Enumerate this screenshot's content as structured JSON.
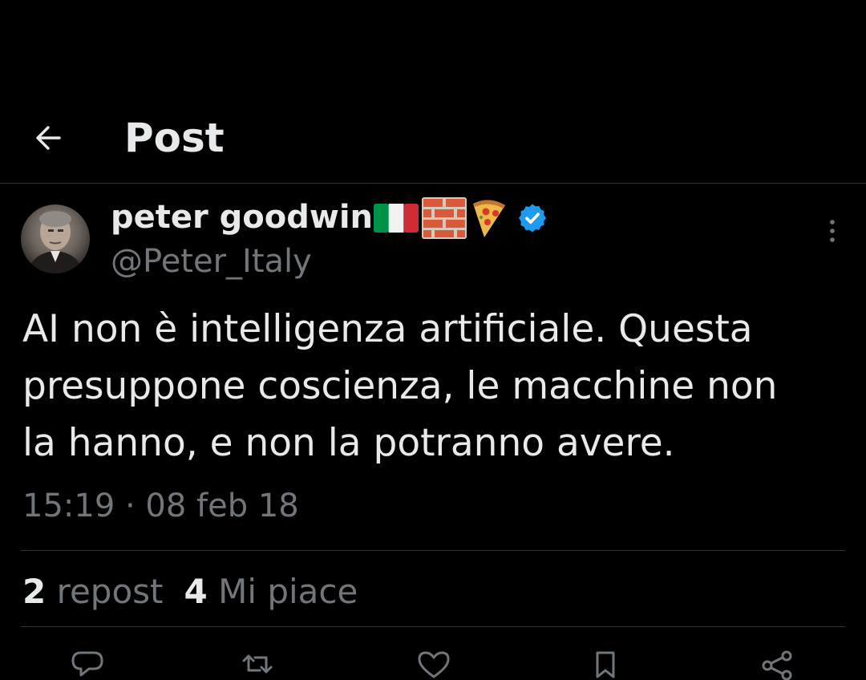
{
  "header": {
    "back_icon": "arrow-left-icon",
    "title": "Post"
  },
  "tweet": {
    "author": {
      "name": "peter goodwin",
      "handle": "@Peter_Italy",
      "emojis": [
        "italy-flag-icon",
        "brick-icon",
        "pizza-icon"
      ],
      "verified_icon": "verified-badge-icon",
      "verified_color": "#1d9bf0"
    },
    "text": "AI non è intelligenza artificiale. Questa\npresuppone coscienza, le macchine non\nla hanno, e non la potranno avere.",
    "timestamp": "15:19 · 08 feb 18",
    "stats": {
      "reposts_count": "2",
      "reposts_label": "repost",
      "likes_count": "4",
      "likes_label": "Mi piace"
    },
    "actions": [
      "reply-icon",
      "repost-icon",
      "like-icon",
      "bookmark-icon",
      "share-icon"
    ]
  },
  "colors": {
    "background": "#000000",
    "text_primary": "#e7e9ea",
    "text_secondary": "#71767b",
    "divider": "#2f3336",
    "accent": "#1d9bf0"
  }
}
